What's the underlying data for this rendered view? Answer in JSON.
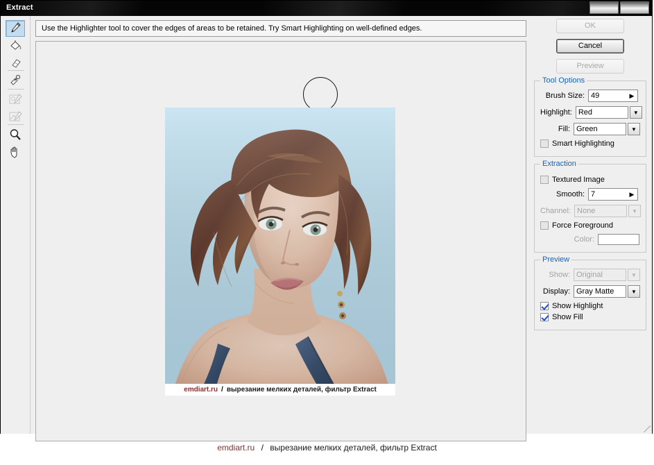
{
  "window": {
    "title": "Extract",
    "controls": [
      "restore-button",
      "close-button"
    ]
  },
  "hint": {
    "text": "Use the Highlighter tool to cover the edges of areas to be retained. Try Smart Highlighting on well-defined edges."
  },
  "toolbar": {
    "tools": [
      {
        "name": "highlighter-tool",
        "icon": "highlighter-icon",
        "selected": true,
        "enabled": true
      },
      {
        "name": "fill-tool",
        "icon": "paint-bucket-icon",
        "selected": false,
        "enabled": true
      },
      {
        "name": "eraser-tool",
        "icon": "eraser-icon",
        "selected": false,
        "enabled": true
      },
      {
        "name": "eyedropper-tool",
        "icon": "eyedropper-icon",
        "selected": false,
        "enabled": true
      },
      {
        "name": "cleanup-tool",
        "icon": "cleanup-icon",
        "selected": false,
        "enabled": false
      },
      {
        "name": "edge-touchup-tool",
        "icon": "edge-touchup-icon",
        "selected": false,
        "enabled": false
      },
      {
        "name": "zoom-tool",
        "icon": "magnifier-icon",
        "selected": false,
        "enabled": true
      },
      {
        "name": "hand-tool",
        "icon": "hand-icon",
        "selected": false,
        "enabled": true
      }
    ]
  },
  "buttons": {
    "ok": "OK",
    "cancel": "Cancel",
    "preview": "Preview"
  },
  "tool_options": {
    "legend": "Tool Options",
    "brush_size_label": "Brush Size:",
    "brush_size_value": "49",
    "highlight_label": "Highlight:",
    "highlight_value": "Red",
    "fill_label": "Fill:",
    "fill_value": "Green",
    "smart_highlighting_label": "Smart Highlighting",
    "smart_highlighting_checked": false
  },
  "extraction": {
    "legend": "Extraction",
    "textured_image_label": "Textured Image",
    "textured_image_checked": false,
    "smooth_label": "Smooth:",
    "smooth_value": "7",
    "channel_label": "Channel:",
    "channel_value": "None",
    "force_foreground_label": "Force Foreground",
    "force_foreground_checked": false,
    "color_label": "Color:",
    "color_value": "#ffffff"
  },
  "preview": {
    "legend": "Preview",
    "show_label": "Show:",
    "show_value": "Original",
    "display_label": "Display:",
    "display_value": "Gray Matte",
    "show_highlight_label": "Show Highlight",
    "show_highlight_checked": true,
    "show_fill_label": "Show Fill",
    "show_fill_checked": true
  },
  "canvas": {
    "brush_cursor": "brush-circle-cursor",
    "photo_description": "portrait-photo-woman-auburn-hair-light-blue-background",
    "photo_background_color": "#b9dced"
  },
  "watermark": {
    "domain": "emdiart.ru",
    "separator": "/",
    "text": "вырезание мелких деталей, фильтр Extract"
  },
  "colors": {
    "legend_blue": "#1662b8",
    "check_blue": "#1a4fd0",
    "panel_bg": "#efefef",
    "titlebar": "#050505"
  }
}
